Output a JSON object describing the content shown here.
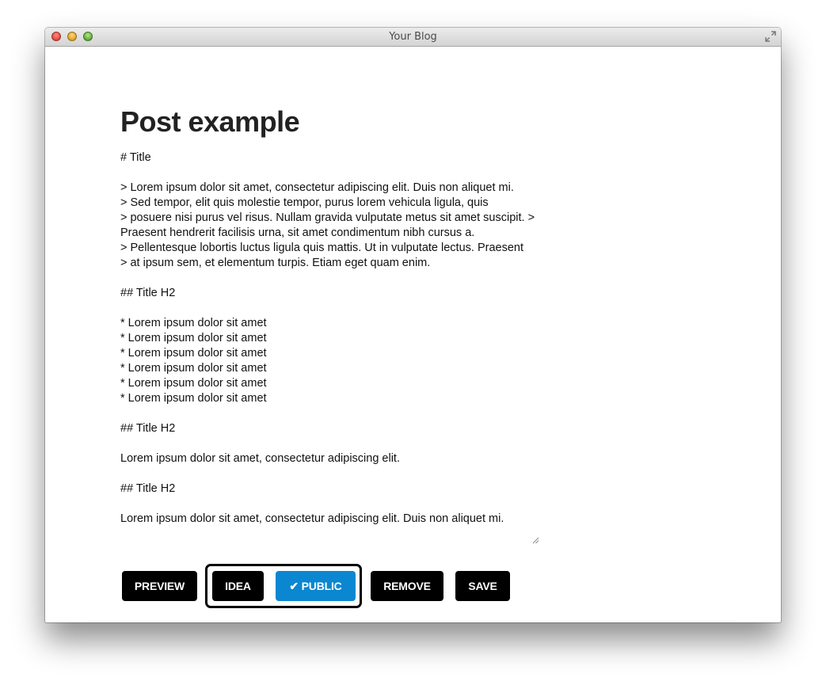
{
  "window": {
    "title": "Your Blog"
  },
  "post": {
    "title": "Post example",
    "body": "# Title\n\n> Lorem ipsum dolor sit amet, consectetur adipiscing elit. Duis non aliquet mi.\n> Sed tempor, elit quis molestie tempor, purus lorem vehicula ligula, quis\n> posuere nisi purus vel risus. Nullam gravida vulputate metus sit amet suscipit. > Praesent hendrerit facilisis urna, sit amet condimentum nibh cursus a.\n> Pellentesque lobortis luctus ligula quis mattis. Ut in vulputate lectus. Praesent\n> at ipsum sem, et elementum turpis. Etiam eget quam enim.\n\n## Title H2\n\n* Lorem ipsum dolor sit amet\n* Lorem ipsum dolor sit amet\n* Lorem ipsum dolor sit amet\n* Lorem ipsum dolor sit amet\n* Lorem ipsum dolor sit amet\n* Lorem ipsum dolor sit amet\n\n## Title H2\n\nLorem ipsum dolor sit amet, consectetur adipiscing elit.\n\n## Title H2\n\nLorem ipsum dolor sit amet, consectetur adipiscing elit. Duis non aliquet mi."
  },
  "actions": {
    "preview_label": "PREVIEW",
    "idea_label": "IDEA",
    "public_label": "✔ PUBLIC",
    "remove_label": "REMOVE",
    "save_label": "SAVE"
  },
  "colors": {
    "active_toggle": "#0b86d0",
    "button": "#000000"
  },
  "icons": {
    "window_close": "close-icon",
    "window_minimize": "minimize-icon",
    "window_zoom": "zoom-icon",
    "fullscreen": "fullscreen-icon",
    "check": "checkmark-icon"
  }
}
